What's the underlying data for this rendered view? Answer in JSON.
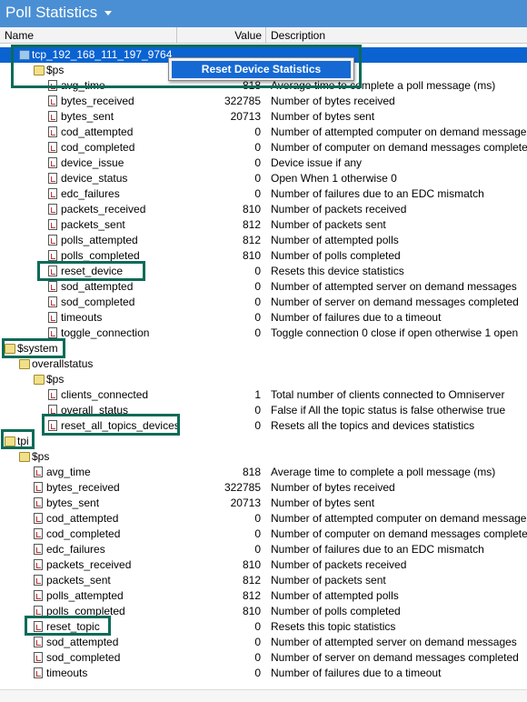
{
  "window": {
    "title": "Poll Statistics"
  },
  "header": {
    "name": "Name",
    "value": "Value",
    "description": "Description"
  },
  "context_menu": {
    "item": "Reset Device Statistics"
  },
  "tree": [
    {
      "label": "tcp_192_168_111_197_9764",
      "value": "",
      "desc": "",
      "icon": "root-folder",
      "level": 1,
      "selected": true,
      "name": "node-tcp-connection"
    },
    {
      "label": "$ps",
      "value": "",
      "desc": "",
      "icon": "folder",
      "level": 2,
      "name": "node-ps"
    },
    {
      "label": "avg_time",
      "value": "818",
      "desc": "Average time to complete a poll message (ms)",
      "icon": "doc",
      "level": 3,
      "name": "node-avg-time"
    },
    {
      "label": "bytes_received",
      "value": "322785",
      "desc": "Number of bytes received",
      "icon": "doc",
      "level": 3,
      "name": "node-bytes-received"
    },
    {
      "label": "bytes_sent",
      "value": "20713",
      "desc": "Number of bytes sent",
      "icon": "doc",
      "level": 3,
      "name": "node-bytes-sent"
    },
    {
      "label": "cod_attempted",
      "value": "0",
      "desc": "Number of attempted computer on demand messages",
      "icon": "doc",
      "level": 3,
      "name": "node-cod-attempted"
    },
    {
      "label": "cod_completed",
      "value": "0",
      "desc": "Number of computer on demand messages completed",
      "icon": "doc",
      "level": 3,
      "name": "node-cod-completed"
    },
    {
      "label": "device_issue",
      "value": "0",
      "desc": "Device issue if any",
      "icon": "doc",
      "level": 3,
      "name": "node-device-issue"
    },
    {
      "label": "device_status",
      "value": "0",
      "desc": "Open When 1 otherwise 0",
      "icon": "doc",
      "level": 3,
      "name": "node-device-status"
    },
    {
      "label": "edc_failures",
      "value": "0",
      "desc": "Number of failures due to an EDC mismatch",
      "icon": "doc",
      "level": 3,
      "name": "node-edc-failures"
    },
    {
      "label": "packets_received",
      "value": "810",
      "desc": "Number of packets received",
      "icon": "doc",
      "level": 3,
      "name": "node-packets-received"
    },
    {
      "label": "packets_sent",
      "value": "812",
      "desc": "Number of packets sent",
      "icon": "doc",
      "level": 3,
      "name": "node-packets-sent"
    },
    {
      "label": "polls_attempted",
      "value": "812",
      "desc": "Number of attempted polls",
      "icon": "doc",
      "level": 3,
      "name": "node-polls-attempted"
    },
    {
      "label": "polls_completed",
      "value": "810",
      "desc": "Number of polls completed",
      "icon": "doc",
      "level": 3,
      "name": "node-polls-completed"
    },
    {
      "label": "reset_device",
      "value": "0",
      "desc": "Resets this device statistics",
      "icon": "doc",
      "level": 3,
      "name": "node-reset-device"
    },
    {
      "label": "sod_attempted",
      "value": "0",
      "desc": "Number of attempted server on demand messages",
      "icon": "doc",
      "level": 3,
      "name": "node-sod-attempted"
    },
    {
      "label": "sod_completed",
      "value": "0",
      "desc": "Number of server on demand messages completed",
      "icon": "doc",
      "level": 3,
      "name": "node-sod-completed"
    },
    {
      "label": "timeouts",
      "value": "0",
      "desc": "Number of failures due to a timeout",
      "icon": "doc",
      "level": 3,
      "name": "node-timeouts"
    },
    {
      "label": "toggle_connection",
      "value": "0",
      "desc": "Toggle connection 0 close if open otherwise 1 open",
      "icon": "doc",
      "level": 3,
      "name": "node-toggle-connection"
    },
    {
      "label": "$system",
      "value": "",
      "desc": "",
      "icon": "folder",
      "level": 0,
      "name": "node-system"
    },
    {
      "label": "overallstatus",
      "value": "",
      "desc": "",
      "icon": "folder",
      "level": 1,
      "name": "node-overallstatus"
    },
    {
      "label": "$ps",
      "value": "",
      "desc": "",
      "icon": "folder",
      "level": 2,
      "name": "node-overallstatus-ps"
    },
    {
      "label": "clients_connected",
      "value": "1",
      "desc": "Total number of clients connected to Omniserver",
      "icon": "doc",
      "level": 3,
      "name": "node-clients-connected"
    },
    {
      "label": "overall_status",
      "value": "0",
      "desc": "False if All the topic status is false otherwise true",
      "icon": "doc",
      "level": 3,
      "name": "node-overall-status"
    },
    {
      "label": "reset_all_topics_devices",
      "value": "0",
      "desc": "Resets all the topics and devices statistics",
      "icon": "doc",
      "level": 3,
      "name": "node-reset-all-topics-devices"
    },
    {
      "label": "tpi",
      "value": "",
      "desc": "",
      "icon": "folder",
      "level": 0,
      "name": "node-tpi"
    },
    {
      "label": "$ps",
      "value": "",
      "desc": "",
      "icon": "folder",
      "level": 1,
      "name": "node-tpi-ps"
    },
    {
      "label": "avg_time",
      "value": "818",
      "desc": "Average time to complete a poll message (ms)",
      "icon": "doc",
      "level": 2,
      "name": "node-tpi-avg-time"
    },
    {
      "label": "bytes_received",
      "value": "322785",
      "desc": "Number of bytes received",
      "icon": "doc",
      "level": 2,
      "name": "node-tpi-bytes-received"
    },
    {
      "label": "bytes_sent",
      "value": "20713",
      "desc": "Number of bytes sent",
      "icon": "doc",
      "level": 2,
      "name": "node-tpi-bytes-sent"
    },
    {
      "label": "cod_attempted",
      "value": "0",
      "desc": "Number of attempted computer on demand messages",
      "icon": "doc",
      "level": 2,
      "name": "node-tpi-cod-attempted"
    },
    {
      "label": "cod_completed",
      "value": "0",
      "desc": "Number of computer on demand messages completed",
      "icon": "doc",
      "level": 2,
      "name": "node-tpi-cod-completed"
    },
    {
      "label": "edc_failures",
      "value": "0",
      "desc": "Number of failures due to an EDC mismatch",
      "icon": "doc",
      "level": 2,
      "name": "node-tpi-edc-failures"
    },
    {
      "label": "packets_received",
      "value": "810",
      "desc": "Number of packets received",
      "icon": "doc",
      "level": 2,
      "name": "node-tpi-packets-received"
    },
    {
      "label": "packets_sent",
      "value": "812",
      "desc": "Number of packets sent",
      "icon": "doc",
      "level": 2,
      "name": "node-tpi-packets-sent"
    },
    {
      "label": "polls_attempted",
      "value": "812",
      "desc": "Number of attempted polls",
      "icon": "doc",
      "level": 2,
      "name": "node-tpi-polls-attempted"
    },
    {
      "label": "polls_completed",
      "value": "810",
      "desc": "Number of polls completed",
      "icon": "doc",
      "level": 2,
      "name": "node-tpi-polls-completed"
    },
    {
      "label": "reset_topic",
      "value": "0",
      "desc": "Resets this topic statistics",
      "icon": "doc",
      "level": 2,
      "name": "node-reset-topic"
    },
    {
      "label": "sod_attempted",
      "value": "0",
      "desc": "Number of attempted server on demand messages",
      "icon": "doc",
      "level": 2,
      "name": "node-tpi-sod-attempted"
    },
    {
      "label": "sod_completed",
      "value": "0",
      "desc": "Number of server on demand messages completed",
      "icon": "doc",
      "level": 2,
      "name": "node-tpi-sod-completed"
    },
    {
      "label": "timeouts",
      "value": "0",
      "desc": "Number of failures due to a timeout",
      "icon": "doc",
      "level": 2,
      "name": "node-tpi-timeouts"
    }
  ]
}
